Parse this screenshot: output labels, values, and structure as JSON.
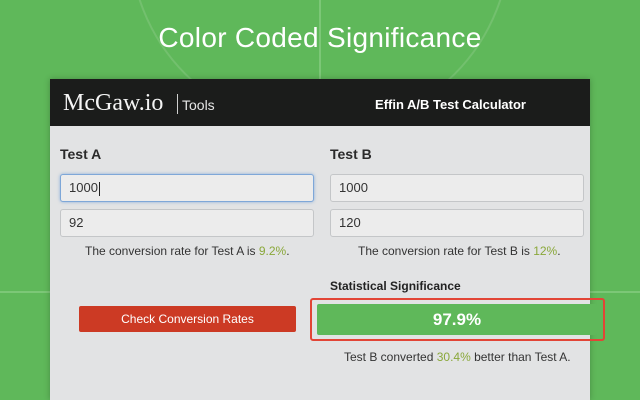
{
  "headline": "Color Coded Significance",
  "header": {
    "brand": "McGaw.io",
    "tools": "Tools",
    "app_title": "Effin A/B Test Calculator"
  },
  "test_a": {
    "label": "Test A",
    "visitors": "1000",
    "conversions": "92",
    "rate_prefix": "The conversion rate for Test A is ",
    "rate": "9.2%",
    "rate_suffix": "."
  },
  "test_b": {
    "label": "Test B",
    "visitors": "1000",
    "conversions": "120",
    "rate_prefix": "The conversion rate for Test B is ",
    "rate": "12%",
    "rate_suffix": "."
  },
  "check_button": "Check Conversion Rates",
  "significance": {
    "label": "Statistical Significance",
    "value": "97.9%",
    "bar_color": "#5fb85a",
    "frame_color": "#e24536"
  },
  "result": {
    "prefix": "Test B converted ",
    "lift": "30.4%",
    "suffix": " better than Test A."
  },
  "colors": {
    "background": "#5fb85a",
    "header": "#1b1c1b",
    "button": "#cc3a24",
    "highlight": "#8aa83a"
  }
}
